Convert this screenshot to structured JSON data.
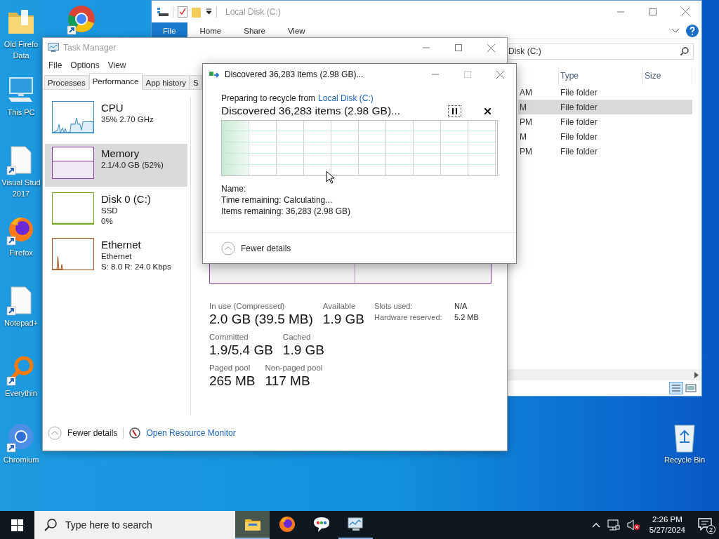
{
  "desktop_icons": [
    {
      "kind": "folder",
      "shortcut": false,
      "lines": [
        "Old Firefo",
        "Data"
      ]
    },
    {
      "kind": "computer",
      "shortcut": false,
      "lines": [
        "This PC"
      ]
    },
    {
      "kind": "document",
      "shortcut": true,
      "lines": [
        "Visual Stud",
        "2017"
      ]
    },
    {
      "kind": "firefox",
      "shortcut": true,
      "lines": [
        "Firefox"
      ]
    },
    {
      "kind": "document",
      "shortcut": true,
      "lines": [
        "Notepad+"
      ]
    },
    {
      "kind": "magnifier",
      "shortcut": true,
      "lines": [
        "Everythin"
      ]
    },
    {
      "kind": "chromium",
      "shortcut": true,
      "lines": [
        "Chromium"
      ]
    },
    {
      "kind": "chrome",
      "shortcut": true
    }
  ],
  "recycle_bin": {
    "label": "Recycle Bin"
  },
  "explorer": {
    "title": "Local Disk (C:)",
    "ribbon_tabs": [
      {
        "label": "File",
        "selected": true
      },
      {
        "label": "Home",
        "selected": false
      },
      {
        "label": "Share",
        "selected": false
      },
      {
        "label": "View",
        "selected": false
      }
    ],
    "address": "Disk (C:)",
    "columns": [
      "Type",
      "Size"
    ],
    "rows": [
      {
        "date": "AM",
        "type": "File folder",
        "selected": false
      },
      {
        "date": "M",
        "type": "File folder",
        "selected": true
      },
      {
        "date": "PM",
        "type": "File folder",
        "selected": false
      },
      {
        "date": "M",
        "type": "File folder",
        "selected": false
      },
      {
        "date": "PM",
        "type": "File folder",
        "selected": false
      }
    ]
  },
  "task_manager": {
    "title": "Task Manager",
    "menu": [
      "File",
      "Options",
      "View"
    ],
    "tabs": [
      {
        "label": "Processes",
        "selected": false
      },
      {
        "label": "Performance",
        "selected": true
      },
      {
        "label": "App history",
        "selected": false
      },
      {
        "label": "S",
        "selected": false
      }
    ],
    "resources": [
      {
        "kind": "cpu",
        "name": "CPU",
        "details": [
          "35%  2.70 GHz"
        ],
        "color": "#3c8fc4",
        "selected": false
      },
      {
        "kind": "memory",
        "name": "Memory",
        "details": [
          "2.1/4.0 GB (52%)"
        ],
        "color": "#8b3fa8",
        "selected": true
      },
      {
        "kind": "disk",
        "name": "Disk 0 (C:)",
        "details": [
          "SSD",
          "0%"
        ],
        "color": "#6fa81e",
        "selected": false
      },
      {
        "kind": "network",
        "name": "Ethernet",
        "details": [
          "Ethernet",
          "S: 8.0 R: 24.0 Kbps"
        ],
        "color": "#a8591e",
        "selected": false
      }
    ],
    "memory_stats": [
      [
        {
          "label": "In use (Compressed)",
          "value": "2.0 GB (39.5 MB)"
        },
        {
          "label": "Available",
          "value": "1.9 GB"
        }
      ],
      [
        {
          "label": "Committed",
          "value": "1.9/5.4 GB"
        },
        {
          "label": "Cached",
          "value": "1.9 GB"
        }
      ],
      [
        {
          "label": "Paged pool",
          "value": "265 MB"
        },
        {
          "label": "Non-paged pool",
          "value": "117 MB"
        }
      ]
    ],
    "memory_properties": [
      {
        "label": "Slots used:",
        "value": "N/A"
      },
      {
        "label": "Hardware reserved:",
        "value": "5.2 MB"
      }
    ],
    "footer": {
      "toggle": "Fewer details",
      "link": "Open Resource Monitor"
    }
  },
  "dialog": {
    "title": "Discovered 36,283 items (2.98 GB)...",
    "source_prefix": "Preparing to recycle from",
    "source_link": "Local Disk (C:)",
    "heading": "Discovered 36,283 items (2.98 GB)...",
    "level": 0.1,
    "details": [
      {
        "label": "Name:"
      },
      {
        "label": "Time remaining:",
        "value": "Calculating..."
      },
      {
        "label": "Items remaining:",
        "value": "36,283 (2.98 GB)"
      }
    ],
    "toggle": "Fewer details"
  },
  "taskbar": {
    "search_placeholder": "Type here to search",
    "apps": [
      {
        "kind": "explorer",
        "active": true,
        "running": true
      },
      {
        "kind": "firefox",
        "active": false,
        "running": false
      },
      {
        "kind": "chat",
        "active": false,
        "running": false
      },
      {
        "kind": "taskmanager",
        "active": false,
        "running": true
      }
    ],
    "time": "2:26 PM",
    "date": "5/27/2024",
    "notifications": "2"
  }
}
